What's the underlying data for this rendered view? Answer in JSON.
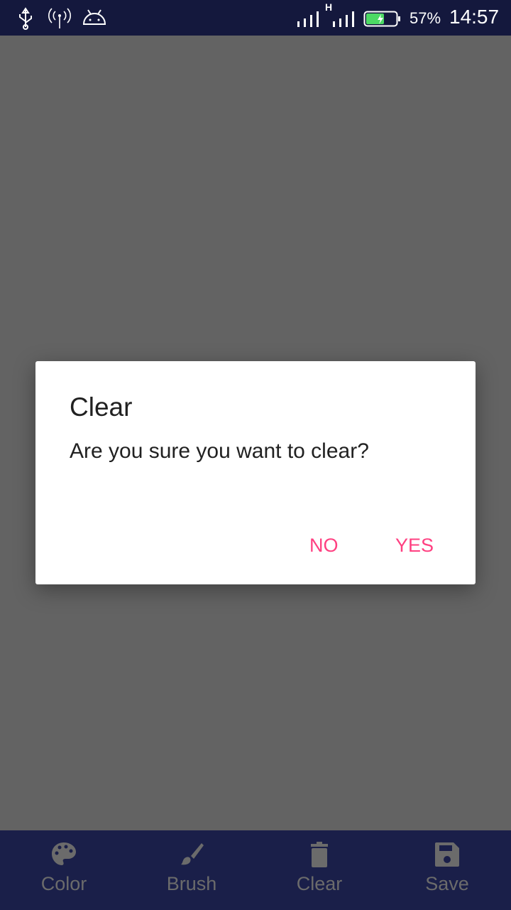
{
  "status_bar": {
    "battery": "57%",
    "time": "14:57",
    "network_type": "H",
    "battery_color": "#4cd964"
  },
  "dialog": {
    "title": "Clear",
    "message": "Are you sure you want to clear?",
    "no_label": "NO",
    "yes_label": "YES",
    "accent": "#ff4081"
  },
  "bottom_nav": {
    "items": [
      {
        "label": "Color",
        "icon": "palette-icon"
      },
      {
        "label": "Brush",
        "icon": "brush-icon"
      },
      {
        "label": "Clear",
        "icon": "trash-icon"
      },
      {
        "label": "Save",
        "icon": "save-icon"
      }
    ]
  }
}
